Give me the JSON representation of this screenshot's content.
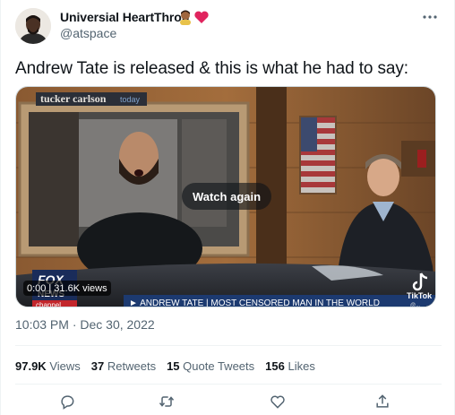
{
  "author": {
    "display_name": "Universial HeartThrob",
    "handle": "@atspace",
    "badge_icons": [
      "man-emoji-icon",
      "red-heart-icon"
    ]
  },
  "tweet": {
    "text": "Andrew Tate is released & this is what he had to say:",
    "timestamp": "10:03 PM · Dec 30, 2022"
  },
  "video": {
    "watch_again_label": "Watch again",
    "current_time": "0:00",
    "separator": "|",
    "views_label": "31.6K views",
    "show_logo_text": "tucker carlson",
    "show_logo_sub": "today",
    "network_logo": "FOX",
    "network_sub": "NEWS",
    "network_channel": "channel",
    "chyron": "► ANDREW TATE | MOST CENSORED MAN IN THE WORLD",
    "watermark": "TikTok",
    "watermark_handle": "@..."
  },
  "stats": {
    "views": {
      "count": "97.9K",
      "label": "Views"
    },
    "retweets": {
      "count": "37",
      "label": "Retweets"
    },
    "quotes": {
      "count": "15",
      "label": "Quote Tweets"
    },
    "likes": {
      "count": "156",
      "label": "Likes"
    }
  },
  "actions": [
    "reply-icon",
    "retweet-icon",
    "like-icon",
    "share-icon"
  ],
  "colors": {
    "text": "#0f1419",
    "secondary": "#536471",
    "divider": "#eff3f4",
    "heart": "#e0245e"
  }
}
